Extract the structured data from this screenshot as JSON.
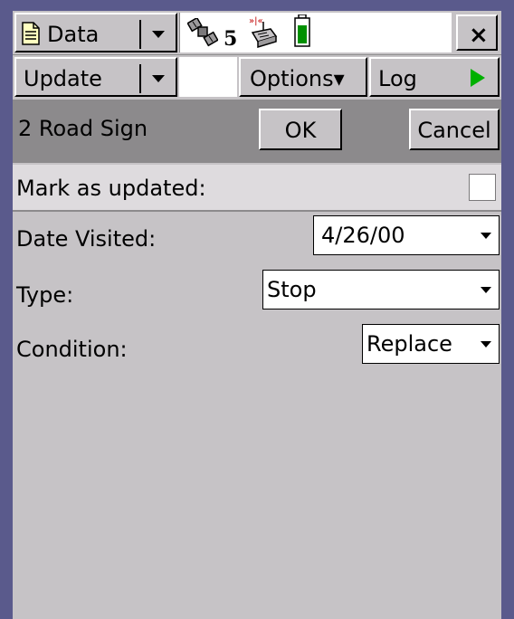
{
  "title_bar": {
    "data_label": "Data",
    "satellite_count": "5",
    "close_glyph": "×"
  },
  "toolbar": {
    "update_label": "Update",
    "options_label": "Options▾",
    "log_label": "Log"
  },
  "feature_bar": {
    "title": "2 Road Sign",
    "ok_label": "OK",
    "cancel_label": "Cancel"
  },
  "form": {
    "mark_updated_label": "Mark as updated:",
    "mark_updated_checked": false,
    "fields": [
      {
        "label": "Date Visited:",
        "value": "4/26/00"
      },
      {
        "label": "Type:",
        "value": "Stop"
      },
      {
        "label": "Condition:",
        "value": "Replace"
      }
    ]
  },
  "icons": {
    "data": "document-icon",
    "satellite": "satellite-icon",
    "gps_receiver": "gps-receiver-icon",
    "battery": "battery-icon",
    "close": "close-icon",
    "log_start": "play-icon"
  },
  "colors": {
    "frame": "#5a5a8c",
    "window_bg": "#c6c3c6",
    "feature_bar": "#8c8a8c",
    "play_green": "#00b000",
    "battery_green": "#009000"
  }
}
